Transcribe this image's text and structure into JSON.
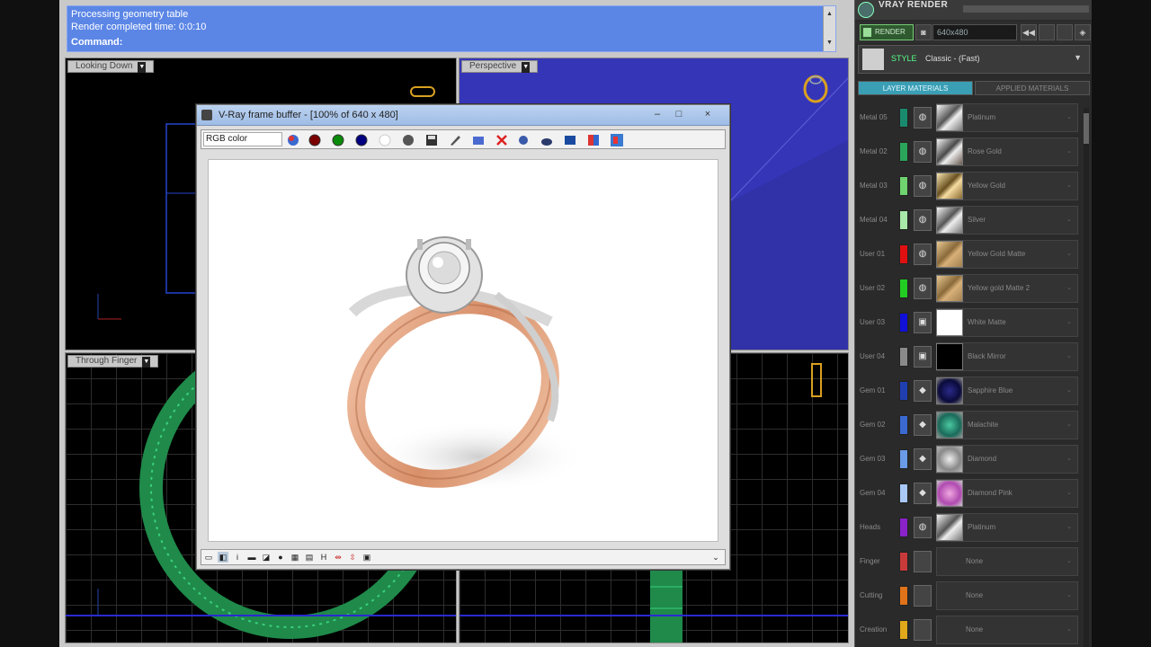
{
  "command": {
    "line1": "Processing geometry table",
    "line2": "Render completed time: 0:0:10",
    "label": "Command:"
  },
  "viewports": {
    "top_left": "Looking Down",
    "top_right": "Perspective",
    "bottom_left": "Through Finger"
  },
  "vfb": {
    "title": "V-Ray frame buffer - [100% of 640 x 480]",
    "channel": "RGB color",
    "minimize": "–",
    "maximize": "□",
    "close": "×"
  },
  "panel": {
    "title": "VRAY RENDER",
    "render_label": "RENDER",
    "resolution": "640x480",
    "style_label": "STYLE",
    "style_value": "Classic - (Fast)",
    "tab_layer": "LAYER MATERIALS",
    "tab_applied": "APPLIED MATERIALS",
    "materials": [
      {
        "name": "Metal 05",
        "color": "#1a8a6e",
        "icon": "ring-icon",
        "thumb": "metal-silver",
        "mat": "Platinum"
      },
      {
        "name": "Metal 02",
        "color": "#2aa55a",
        "icon": "ring-icon",
        "thumb": "metal-rose",
        "mat": "Rose Gold"
      },
      {
        "name": "Metal 03",
        "color": "#6fd36f",
        "icon": "ring-icon",
        "thumb": "metal-gold",
        "mat": "Yellow Gold"
      },
      {
        "name": "Metal 04",
        "color": "#a8e8a8",
        "icon": "ring-icon",
        "thumb": "metal-silver",
        "mat": "Silver"
      },
      {
        "name": "User 01",
        "color": "#e01010",
        "icon": "ring-icon",
        "thumb": "metal-gold-matte",
        "mat": "Yellow Gold Matte"
      },
      {
        "name": "User 02",
        "color": "#22cc22",
        "icon": "ring-icon",
        "thumb": "metal-gold-matte",
        "mat": "Yellow gold Matte 2"
      },
      {
        "name": "User 03",
        "color": "#1010d8",
        "icon": "cube-icon",
        "thumb": "white",
        "mat": "White Matte"
      },
      {
        "name": "User 04",
        "color": "#8a8a8a",
        "icon": "cube-icon",
        "thumb": "black",
        "mat": "Black Mirror"
      },
      {
        "name": "Gem 01",
        "color": "#1f3fb0",
        "icon": "gem-icon",
        "thumb": "gem-blue",
        "mat": "Sapphire Blue"
      },
      {
        "name": "Gem 02",
        "color": "#3a6ad0",
        "icon": "gem-icon",
        "thumb": "gem-green",
        "mat": "Malachite"
      },
      {
        "name": "Gem 03",
        "color": "#6a9be8",
        "icon": "gem-icon",
        "thumb": "gem-diamond",
        "mat": "Diamond"
      },
      {
        "name": "Gem 04",
        "color": "#a9c8f5",
        "icon": "gem-icon",
        "thumb": "gem-pink",
        "mat": "Diamond Pink"
      },
      {
        "name": "Heads",
        "color": "#8a22c8",
        "icon": "ring-icon",
        "thumb": "metal-silver",
        "mat": "Platinum"
      },
      {
        "name": "Finger",
        "color": "#c83a3a",
        "icon": "",
        "thumb": "",
        "mat": "None"
      },
      {
        "name": "Cutting",
        "color": "#e0731a",
        "icon": "",
        "thumb": "",
        "mat": "None"
      },
      {
        "name": "Creation",
        "color": "#e0a81a",
        "icon": "",
        "thumb": "",
        "mat": "None"
      }
    ]
  }
}
